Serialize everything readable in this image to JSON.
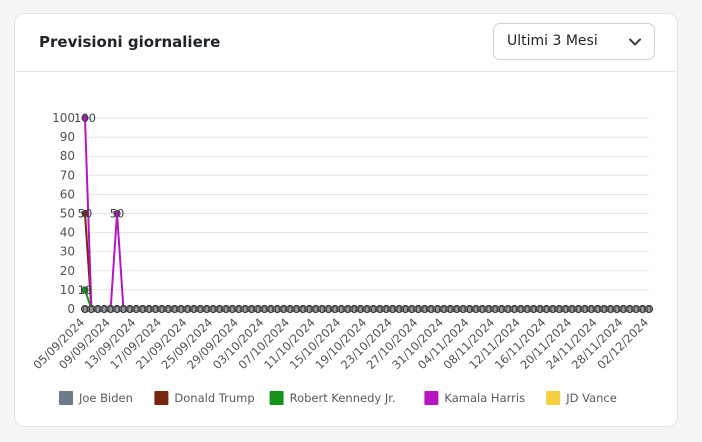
{
  "card": {
    "title": "Previsioni giornaliere"
  },
  "range_select": {
    "value": "Ultimi 3 Mesi",
    "icon": "chevron-down-icon"
  },
  "chart_data": {
    "type": "line",
    "y_ticks": [
      0,
      10,
      20,
      30,
      40,
      50,
      60,
      70,
      80,
      90,
      100
    ],
    "ylim": [
      0,
      100
    ],
    "x_tick_labels": [
      "05/09/2024",
      "09/09/2024",
      "13/09/2024",
      "17/09/2024",
      "21/09/2024",
      "25/09/2024",
      "29/09/2024",
      "03/10/2024",
      "07/10/2024",
      "11/10/2024",
      "15/10/2024",
      "19/10/2024",
      "23/10/2024",
      "27/10/2024",
      "31/10/2024",
      "04/11/2024",
      "08/11/2024",
      "12/11/2024",
      "16/11/2024",
      "20/11/2024",
      "24/11/2024",
      "28/11/2024",
      "02/12/2024"
    ],
    "x_start": "05/09/2024",
    "x_end": "02/12/2024",
    "show_point_labels": true,
    "grid": true,
    "legend_position": "bottom",
    "series": [
      {
        "name": "Joe Biden",
        "color": "#6c7a89",
        "points": []
      },
      {
        "name": "Donald Trump",
        "color": "#7a2511",
        "points": [
          [
            "05/09/2024",
            50
          ],
          [
            "06/09/2024",
            0
          ]
        ]
      },
      {
        "name": "Robert Kennedy Jr.",
        "color": "#17921b",
        "points": [
          [
            "05/09/2024",
            10
          ],
          [
            "06/09/2024",
            0
          ]
        ]
      },
      {
        "name": "Kamala Harris",
        "color": "#b815c2",
        "points": [
          [
            "05/09/2024",
            100
          ],
          [
            "06/09/2024",
            0
          ],
          [
            "09/09/2024",
            0
          ],
          [
            "10/09/2024",
            50
          ],
          [
            "11/09/2024",
            0
          ]
        ]
      },
      {
        "name": "JD Vance",
        "color": "#f6cf3f",
        "points": []
      }
    ]
  }
}
